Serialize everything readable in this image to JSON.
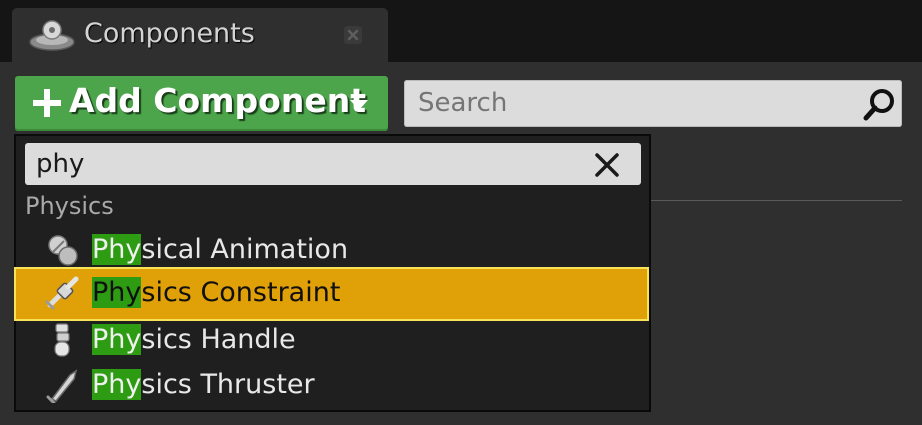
{
  "tab": {
    "title": "Components",
    "icon": "components-icon",
    "close_icon": "close-icon"
  },
  "toolbar": {
    "add_component_label": "Add Component",
    "add_icon": "plus-icon",
    "dropdown_icon": "chevron-down-icon",
    "search": {
      "placeholder": "Search",
      "value": "",
      "icon": "search-icon"
    }
  },
  "picker": {
    "filter_value": "phy",
    "clear_icon": "close-icon",
    "category": "Physics",
    "items": [
      {
        "match": "Phy",
        "rest": "sical Animation",
        "icon": "physical-animation-icon",
        "selected": false
      },
      {
        "match": "Phy",
        "rest": "sics Constraint",
        "icon": "physics-constraint-icon",
        "selected": true
      },
      {
        "match": "Phy",
        "rest": "sics Handle",
        "icon": "physics-handle-icon",
        "selected": false
      },
      {
        "match": "Phy",
        "rest": "sics Thruster",
        "icon": "physics-thruster-icon",
        "selected": false
      }
    ]
  },
  "colors": {
    "add_button": "#4ca54b",
    "selection": "#e0a008",
    "selection_border": "#f7e35a",
    "match_highlight": "#2e9c12"
  }
}
